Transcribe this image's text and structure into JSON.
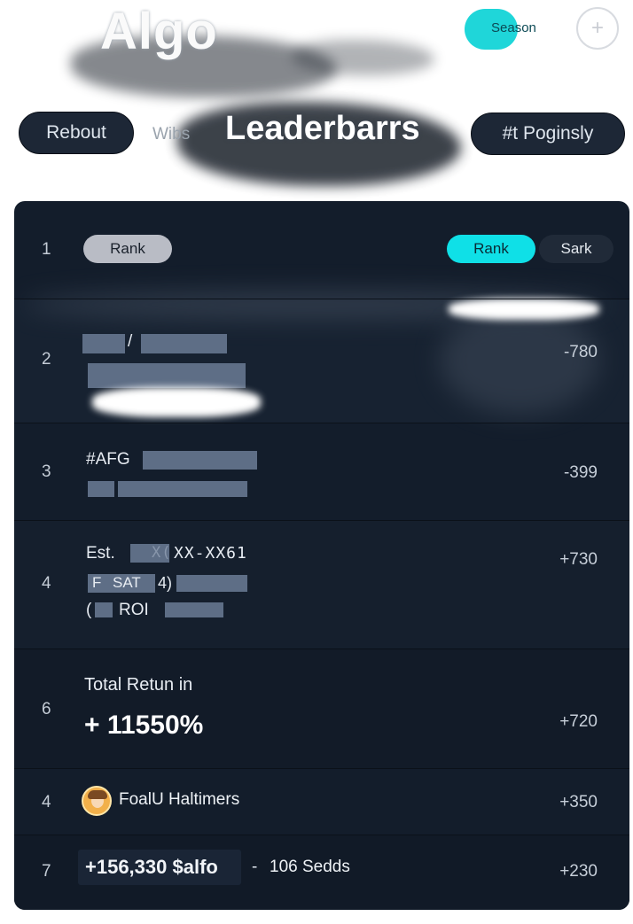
{
  "header": {
    "logo_text": "Algo",
    "season_label": "Season",
    "add_icon": "plus-icon",
    "title": "Leaderbarrs",
    "nav": {
      "left_pill": "Rebout",
      "side_label": "Wibs",
      "right_pill": "#t Poginsly"
    }
  },
  "colors": {
    "accent": "#0fe0e7",
    "board_bg": "#131d2b",
    "pill_bg": "#1d2736"
  },
  "board": {
    "row1": {
      "rank": "1",
      "filter_tab": "Rank",
      "tabs": [
        "Rank",
        "Sark"
      ],
      "active_tab": "Rank"
    },
    "row2": {
      "rank": "2",
      "separator": "/",
      "score": "-780"
    },
    "row3": {
      "rank": "3",
      "tag": "#AFG",
      "score": "-399"
    },
    "row4": {
      "rank": "4",
      "line1_prefix": "Est.",
      "line1_faded": "X(",
      "line1_code": "XX-XX61",
      "line2_prefix": "F",
      "line2_chip": "SAT",
      "line2_digit": "4)",
      "line3_prefix": "(",
      "line3_label": "ROI",
      "score": "+730"
    },
    "row5": {
      "rank": "6",
      "label": "Total Retun in",
      "value": "+ 11550%",
      "score": "+720"
    },
    "row6": {
      "rank": "4",
      "avatar_icon": "user-avatar-icon",
      "name": "FoalU Haltimers",
      "score": "+350"
    },
    "row7": {
      "rank": "7",
      "pnl": "+156,330 $alfo",
      "separator": "-",
      "trades": "106 Sedds",
      "score": "+230"
    }
  }
}
